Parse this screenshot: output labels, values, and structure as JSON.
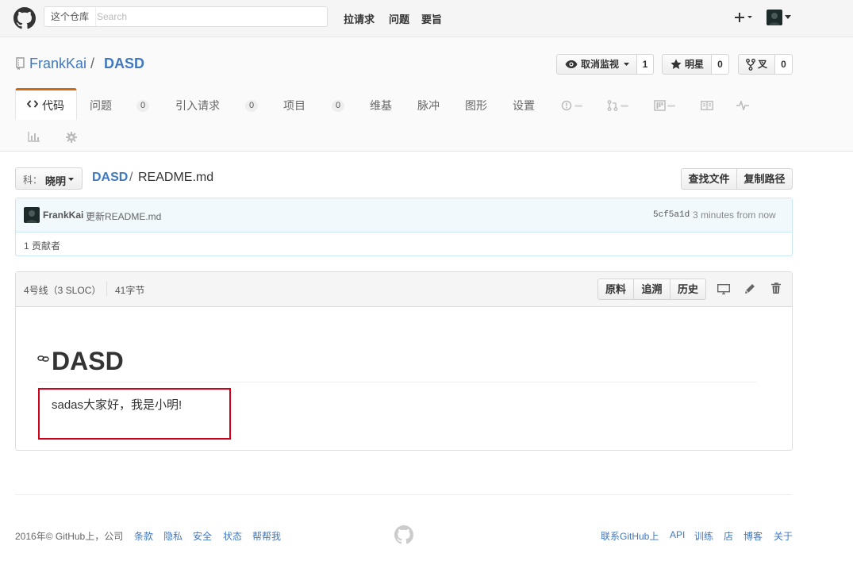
{
  "header": {
    "scope_label": "这个仓库",
    "search_placeholder": "Search",
    "nav": [
      "拉请求",
      "问题",
      "要旨"
    ],
    "plus_icon": "plus-icon",
    "avatar_icon": "avatar"
  },
  "repo": {
    "owner": "FrankKai",
    "separator": "/",
    "name": "DASD",
    "watch_label": "取消监视",
    "watch_count": "1",
    "star_label": "明星",
    "star_count": "0",
    "fork_label": "叉",
    "fork_count": "0"
  },
  "tabs": {
    "code": "代码",
    "issues": "问题",
    "issues_count": "0",
    "pulls": "引入请求",
    "pulls_count": "0",
    "projects": "项目",
    "projects_count": "0",
    "wiki": "维基",
    "pulse": "脉冲",
    "graphs": "图形",
    "settings": "设置"
  },
  "file_nav": {
    "branch_prefix": "科：",
    "branch_name": "晓明",
    "repo_link": "DASD",
    "separator": "/",
    "file_name": "README.md",
    "find_file": "查找文件",
    "copy_path": "复制路径"
  },
  "commit": {
    "author": "FrankKai",
    "message": "更新README.md",
    "sha": "5cf5a1d",
    "time": "3 minutes from now",
    "contributors": "1 贡献者"
  },
  "file": {
    "lines": "4号线（3 SLOC）",
    "size": "41字节",
    "raw": "原料",
    "blame": "追溯",
    "history": "历史",
    "heading": "DASD",
    "content": "sadas大家好，我是小明!"
  },
  "footer": {
    "copyright": "2016年© GitHub上，公司",
    "left_links": [
      "条款",
      "隐私",
      "安全",
      "状态",
      "帮帮我"
    ],
    "right_links": [
      "联系GitHub上",
      "API",
      "训练",
      "店",
      "博客",
      "关于"
    ]
  },
  "colors": {
    "link": "#4078c0",
    "tab_accent": "#d26911",
    "highlight_box": "#d0021b"
  }
}
